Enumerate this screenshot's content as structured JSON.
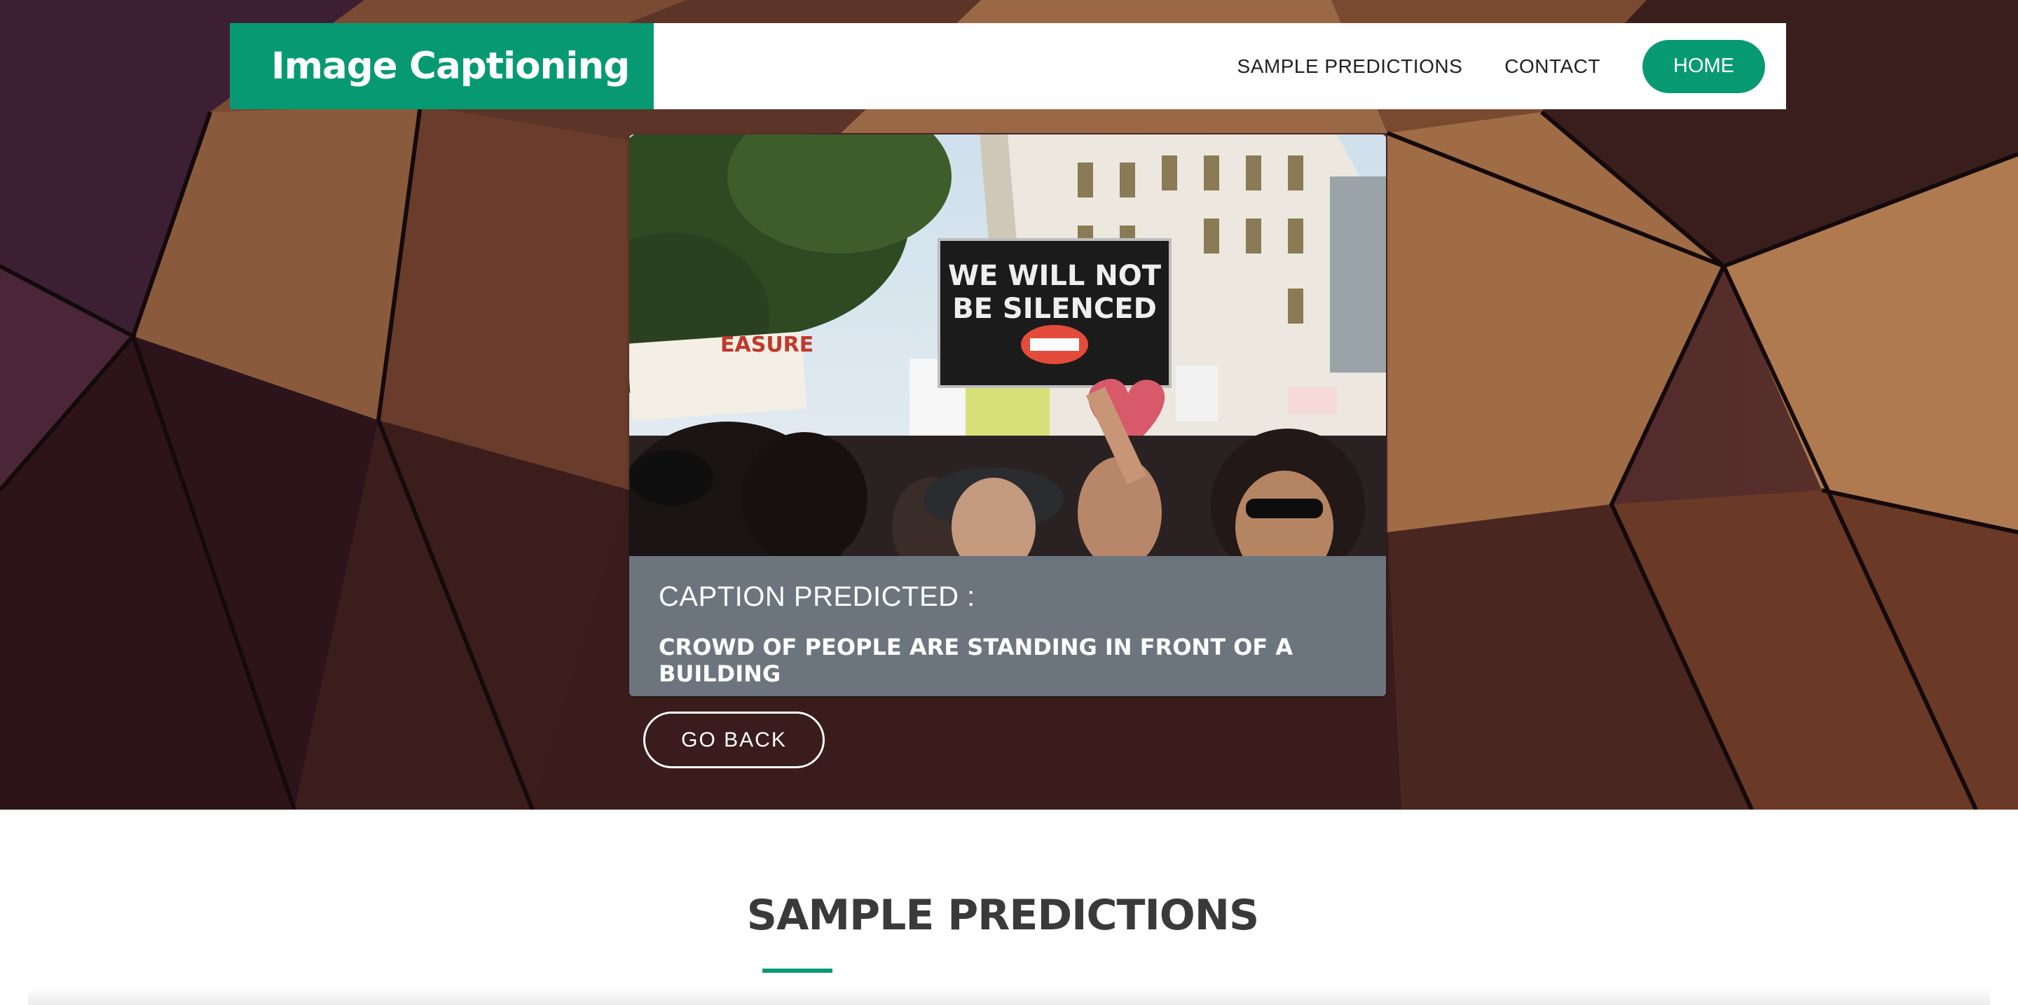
{
  "header": {
    "brand": "Image Captioning",
    "nav": {
      "sample_predictions": "SAMPLE PREDICTIONS",
      "contact": "CONTACT",
      "home": "HOME"
    }
  },
  "result": {
    "photo_sign_text": "WE WILL NOT BE SILENCED",
    "caption_label": "CAPTION PREDICTED :",
    "caption_text": "CROWD OF PEOPLE ARE STANDING IN FRONT OF A BUILDING"
  },
  "actions": {
    "go_back": "GO BACK"
  },
  "section": {
    "title": "SAMPLE PREDICTIONS"
  },
  "colors": {
    "accent": "#079a72",
    "caption_bg": "#6c757d"
  }
}
